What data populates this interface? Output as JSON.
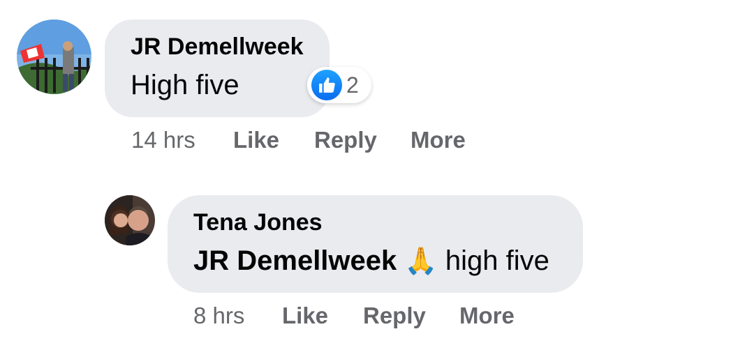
{
  "comments": [
    {
      "author": "JR Demellweek",
      "text": "High five",
      "reaction": {
        "icon": "like-icon",
        "count": "2"
      },
      "time": "14 hrs",
      "actions": {
        "like": "Like",
        "reply": "Reply",
        "more": "More"
      }
    },
    {
      "author": "Tena Jones",
      "mention": "JR Demellweek",
      "emoji": "🙏",
      "text": "high five",
      "time": "8 hrs",
      "actions": {
        "like": "Like",
        "reply": "Reply",
        "more": "More"
      }
    }
  ],
  "colors": {
    "bubble": "#eaebef",
    "meta": "#65676b",
    "like_blue": "#1877f2"
  }
}
